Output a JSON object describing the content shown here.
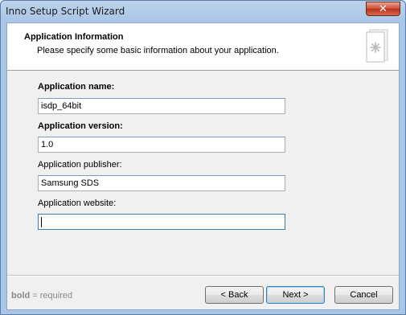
{
  "window": {
    "title": "Inno Setup Script Wizard",
    "close_label": "✕"
  },
  "header": {
    "title": "Application Information",
    "subtitle": "Please specify some basic information about your application.",
    "icon": "wizard-page-icon"
  },
  "fields": [
    {
      "label": "Application name:",
      "value": "isdp_64bit",
      "required": true
    },
    {
      "label": "Application version:",
      "value": "1.0",
      "required": true
    },
    {
      "label": "Application publisher:",
      "value": "Samsung SDS",
      "required": false
    },
    {
      "label": "Application website:",
      "value": "",
      "required": false
    }
  ],
  "footer": {
    "legend_bold": "bold",
    "legend_rest": " = required",
    "back_label": "< Back",
    "next_label": "Next >",
    "cancel_label": "Cancel"
  }
}
